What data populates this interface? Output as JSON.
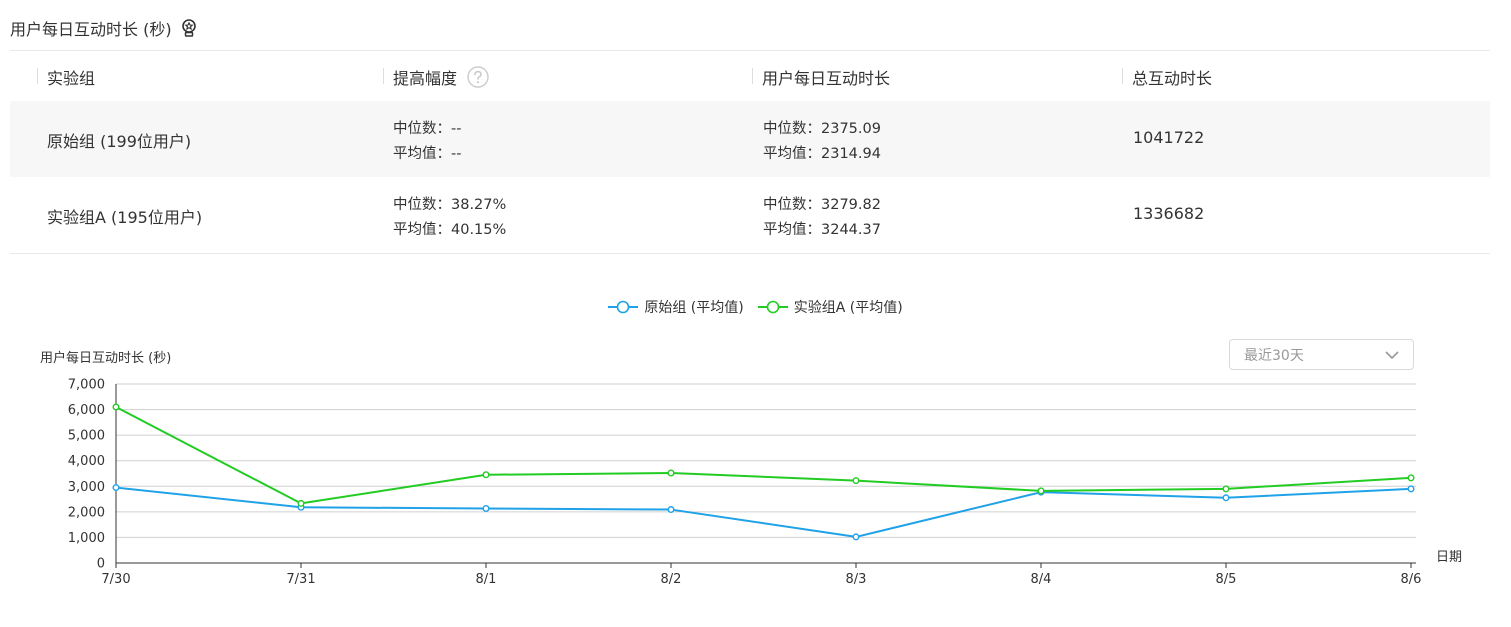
{
  "header": {
    "title": "用户每日互动时长 (秒)",
    "icon": "award-icon"
  },
  "table": {
    "columns": [
      "实验组",
      "提高幅度",
      "用户每日互动时长",
      "总互动时长"
    ],
    "rows": [
      {
        "group": "原始组 (199位用户)",
        "lift_median": "中位数：--",
        "lift_mean": "平均值：--",
        "daily_median": "中位数：2375.09",
        "daily_mean": "平均值：2314.94",
        "total": "1041722"
      },
      {
        "group": "实验组A (195位用户)",
        "lift_median": "中位数：38.27%",
        "lift_mean": "平均值：40.15%",
        "daily_median": "中位数：3279.82",
        "daily_mean": "平均值：3244.37",
        "total": "1336682"
      }
    ]
  },
  "range_select": {
    "value": "最近30天"
  },
  "colors": {
    "original": "#1fa2e8",
    "variant": "#22cc22"
  },
  "chart_data": {
    "type": "line",
    "categories": [
      "7/30",
      "7/31",
      "8/1",
      "8/2",
      "8/3",
      "8/4",
      "8/5",
      "8/6"
    ],
    "series": [
      {
        "name": "原始组 (平均值)",
        "values": [
          2950,
          2180,
          2130,
          2090,
          1020,
          2770,
          2550,
          2900
        ]
      },
      {
        "name": "实验组A (平均值)",
        "values": [
          6100,
          2330,
          3450,
          3520,
          3220,
          2820,
          2900,
          3330
        ]
      }
    ],
    "ylabel": "用户每日互动时长 (秒)",
    "xlabel": "日期",
    "ylim": [
      0,
      7000
    ],
    "yticks": [
      "0",
      "1,000",
      "2,000",
      "3,000",
      "4,000",
      "5,000",
      "6,000",
      "7,000"
    ],
    "grid": true,
    "legend": "top-center"
  }
}
